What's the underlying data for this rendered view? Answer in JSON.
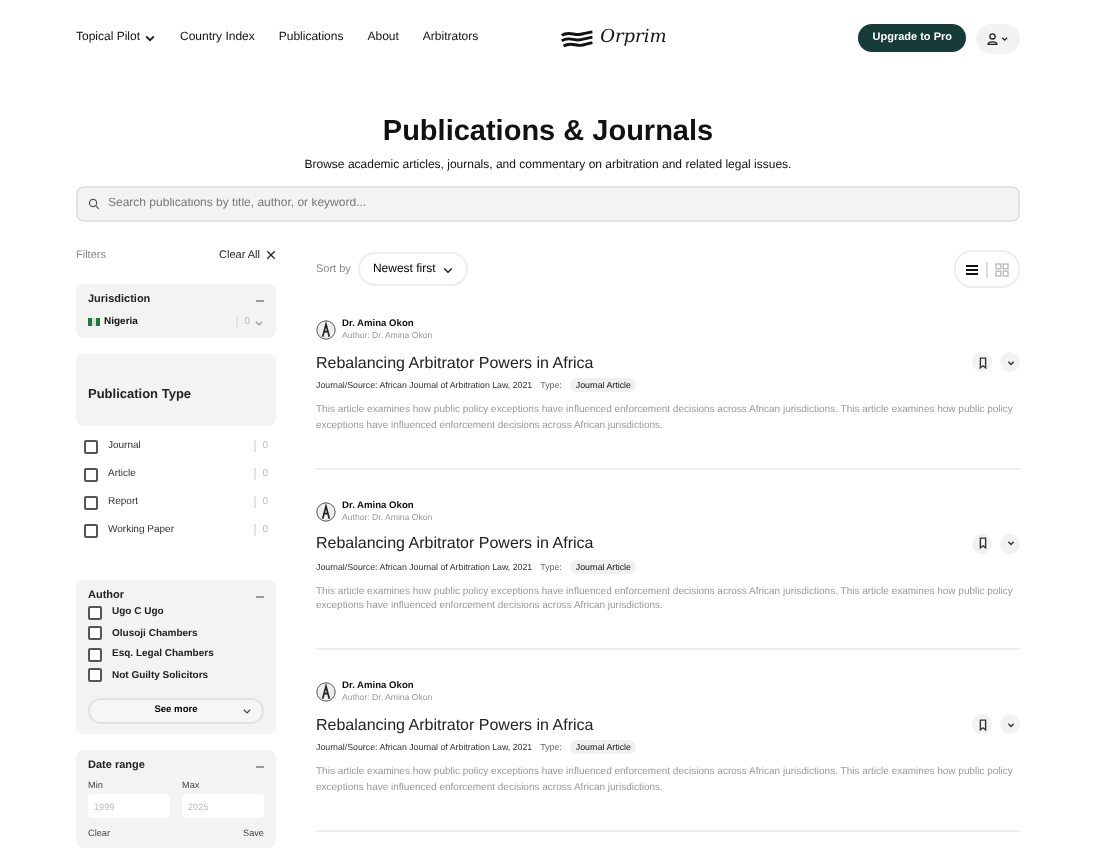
{
  "nav": {
    "items": [
      {
        "label": "Topical Pilot",
        "dropdown": true
      },
      {
        "label": "Country Index",
        "dropdown": false
      },
      {
        "label": "Publications",
        "dropdown": false
      },
      {
        "label": "About",
        "dropdown": false
      },
      {
        "label": "Arbitrators",
        "dropdown": false
      }
    ],
    "logo": "Orprim",
    "upgrade": "Upgrade to Pro"
  },
  "header": {
    "title": "Publications & Journals",
    "subtitle": "Browse academic articles, journals, and commentary on arbitration and related legal issues."
  },
  "search": {
    "placeholder": "Search publications by title, author, or keyword..."
  },
  "filters": {
    "title": "Filters",
    "clear_all": "Clear All",
    "jurisdiction": {
      "title": "Jurisdiction",
      "items": [
        {
          "label": "Nigeria",
          "count": "0"
        }
      ]
    },
    "publication_type": {
      "title": "Publication Type",
      "options": [
        {
          "label": "Journal",
          "count": "0",
          "checked": false
        },
        {
          "label": "Article",
          "count": "0",
          "checked": false
        },
        {
          "label": "Report",
          "count": "0",
          "checked": false
        },
        {
          "label": "Working Paper",
          "count": "0",
          "checked": false
        }
      ]
    },
    "author": {
      "title": "Author",
      "options": [
        {
          "label": "Ugo C Ugo",
          "checked": false
        },
        {
          "label": "Olusoji Chambers",
          "checked": false
        },
        {
          "label": "Esq. Legal Chambers",
          "checked": false
        },
        {
          "label": "Not Guilty Solicitors",
          "checked": false
        }
      ],
      "see_more": "See more"
    },
    "date_range": {
      "title": "Date range",
      "min_label": "Min",
      "max_label": "Max",
      "min_placeholder": "1999",
      "max_placeholder": "2025",
      "clear": "Clear",
      "save": "Save"
    }
  },
  "sort": {
    "label": "Sort by",
    "value": "Newest first",
    "views": [
      {
        "kind": "list",
        "selected": true
      },
      {
        "kind": "grid",
        "selected": false
      }
    ]
  },
  "articles": [
    {
      "author": "Dr. Amina Okon",
      "author_line": "Author: Dr. Amina Okon",
      "title": "Rebalancing Arbitrator Powers in Africa",
      "source": "Journal/Source: African Journal of Arbitration Law, 2021",
      "type_label": "Type:",
      "type": "Journal Article",
      "description": "This article examines how public policy exceptions have influenced enforcement decisions across African jurisdictions. This article examines how public policy exceptions have influenced enforcement decisions across African jurisdictions."
    },
    {
      "author": "Dr. Amina Okon",
      "author_line": "Author: Dr. Amina Okon",
      "title": "Rebalancing Arbitrator Powers in Africa",
      "source": "Journal/Source: African Journal of Arbitration Law, 2021",
      "type_label": "Type:",
      "type": "Journal Article",
      "description": "This article examines how public policy exceptions have influenced enforcement decisions across African jurisdictions. This article examines how public policy exceptions have influenced enforcement decisions across African jurisdictions."
    },
    {
      "author": "Dr. Amina Okon",
      "author_line": "Author: Dr. Amina Okon",
      "title": "Rebalancing Arbitrator Powers in Africa",
      "source": "Journal/Source: African Journal of Arbitration Law, 2021",
      "type_label": "Type:",
      "type": "Journal Article",
      "description": "This article examines how public policy exceptions have influenced enforcement decisions across African jurisdictions. This article examines how public policy exceptions have influenced enforcement decisions across African jurisdictions."
    }
  ]
}
